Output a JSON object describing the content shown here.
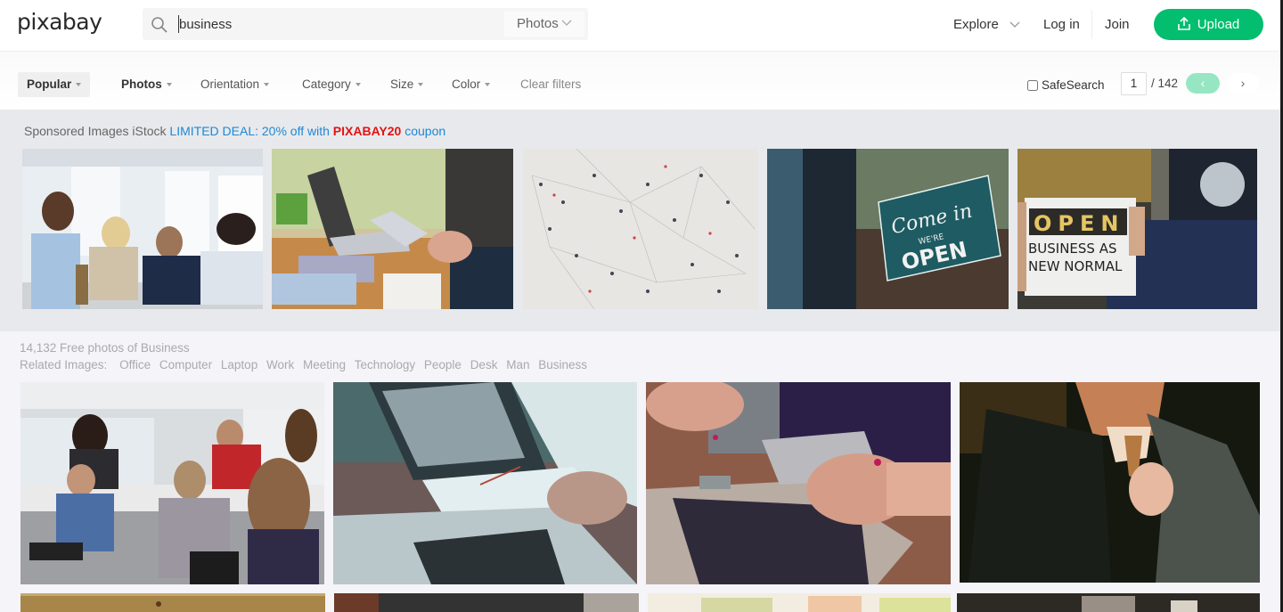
{
  "header": {
    "logo": "pixabay",
    "search": {
      "value": "business",
      "placeholder": ""
    },
    "type_select": "Photos",
    "explore": "Explore",
    "login": "Log in",
    "join": "Join",
    "upload": "Upload",
    "colors": {
      "accent": "#02be6e"
    }
  },
  "filters": {
    "popular": "Popular",
    "photos": "Photos",
    "orientation": "Orientation",
    "category": "Category",
    "size": "Size",
    "color": "Color",
    "clear": "Clear filters",
    "safesearch": "SafeSearch",
    "safesearch_checked": false,
    "page": "1",
    "page_total": "/ 142",
    "prev": "‹",
    "next": "›"
  },
  "sponsored": {
    "prefix": "Sponsored Images iStock",
    "deal": "LIMITED DEAL: 20% off with",
    "code": "PIXABAY20",
    "suffix": "coupon",
    "images": [
      {
        "alt": "Business team meeting at office table"
      },
      {
        "alt": "Laptop and tablet with charts on wooden desk"
      },
      {
        "alt": "Aerial crowd of people connected by network lines"
      },
      {
        "alt": "Come in we're open sign on door"
      },
      {
        "alt": "Person hanging OPEN business as new normal sign"
      }
    ]
  },
  "results": {
    "count_text": "14,132 Free photos of Business",
    "related_label": "Related Images:",
    "related": [
      "Office",
      "Computer",
      "Laptop",
      "Work",
      "Meeting",
      "Technology",
      "People",
      "Desk",
      "Man",
      "Business"
    ],
    "images": [
      {
        "alt": "Team discussion in modern office"
      },
      {
        "alt": "Hands writing on paper next to laptop"
      },
      {
        "alt": "Woman holding smartphone over laptop"
      },
      {
        "alt": "Man in suit adjusting tie"
      },
      {
        "alt": "Wooden desk"
      },
      {
        "alt": "Dark office scene"
      },
      {
        "alt": "Blurred green plant"
      },
      {
        "alt": "Cafe scene"
      }
    ]
  }
}
